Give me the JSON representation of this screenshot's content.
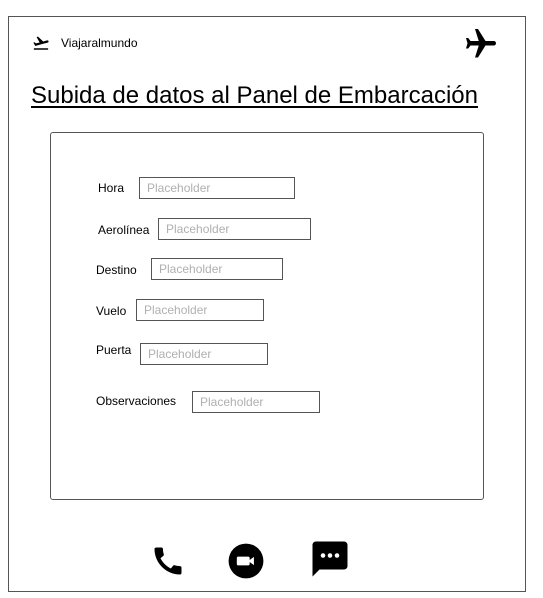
{
  "header": {
    "brand_name": "Viajaralmundo",
    "brand_icon": "airplane-takeoff-icon",
    "plane_icon": "airplane-icon"
  },
  "page": {
    "title": "Subida de datos al Panel de Embarcación"
  },
  "form": {
    "fields": [
      {
        "label": "Hora",
        "placeholder": "Placeholder"
      },
      {
        "label": "Aerolínea",
        "placeholder": "Placeholder"
      },
      {
        "label": "Destino",
        "placeholder": "Placeholder"
      },
      {
        "label": "Vuelo",
        "placeholder": "Placeholder"
      },
      {
        "label": "Puerta",
        "placeholder": "Placeholder"
      },
      {
        "label": "Observaciones",
        "placeholder": "Placeholder"
      }
    ]
  },
  "footer": {
    "icons": [
      "phone-icon",
      "video-call-icon",
      "chat-icon"
    ]
  }
}
